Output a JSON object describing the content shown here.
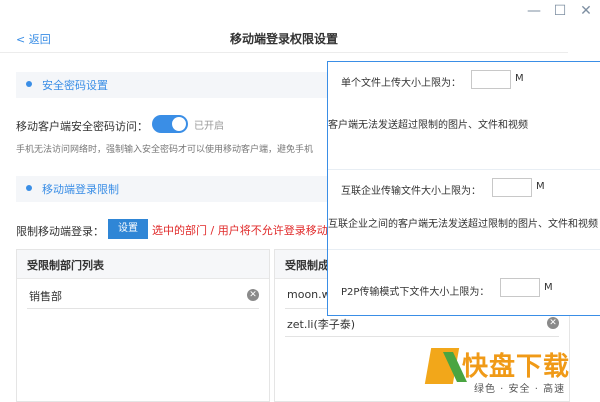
{
  "window": {
    "controls": [
      "—",
      "☐",
      "✕"
    ]
  },
  "header": {
    "back_label": "< 返回",
    "title": "移动端登录权限设置"
  },
  "sections": {
    "password": {
      "title": "安全密码设置"
    },
    "login": {
      "title": "移动端登录限制"
    }
  },
  "password_setting": {
    "label": "移动客户端安全密码访问：",
    "toggle_state": "已开启",
    "hint": "手机无法访问网络时，强制输入安全密码才可以使用移动客户端，避免手机"
  },
  "login_limit": {
    "label": "限制移动端登录：",
    "button_label": "设置",
    "warning": "选中的部门 / 用户将不允许登录移动"
  },
  "dept_panel": {
    "title": "受限制部门列表",
    "items": [
      "销售部"
    ]
  },
  "member_panel": {
    "title": "受限制成员",
    "items": [
      "moon.wu",
      "zet.li(李子泰)"
    ]
  },
  "popup": {
    "single_label": "单个文件上传大小上限为：",
    "single_unit": "M",
    "single_note": "客户端无法发送超过限制的图片、文件和视频",
    "enterprise_label": "互联企业传输文件大小上限为：",
    "enterprise_unit": "M",
    "enterprise_note": "互联企业之间的客户端无法发送超过限制的图片、文件和视频",
    "p2p_label": "P2P传输模式下文件大小上限为：",
    "p2p_unit": "M"
  },
  "watermark": {
    "brand": "快盘下载",
    "tagline": "绿色 · 安全 · 高速"
  },
  "colors": {
    "accent": "#3a8ee6",
    "warning": "#e02a2a",
    "brand": "#f09a17"
  },
  "icons": [
    "minimize-icon",
    "maximize-icon",
    "close-icon",
    "remove-icon",
    "status-dot-icon"
  ]
}
